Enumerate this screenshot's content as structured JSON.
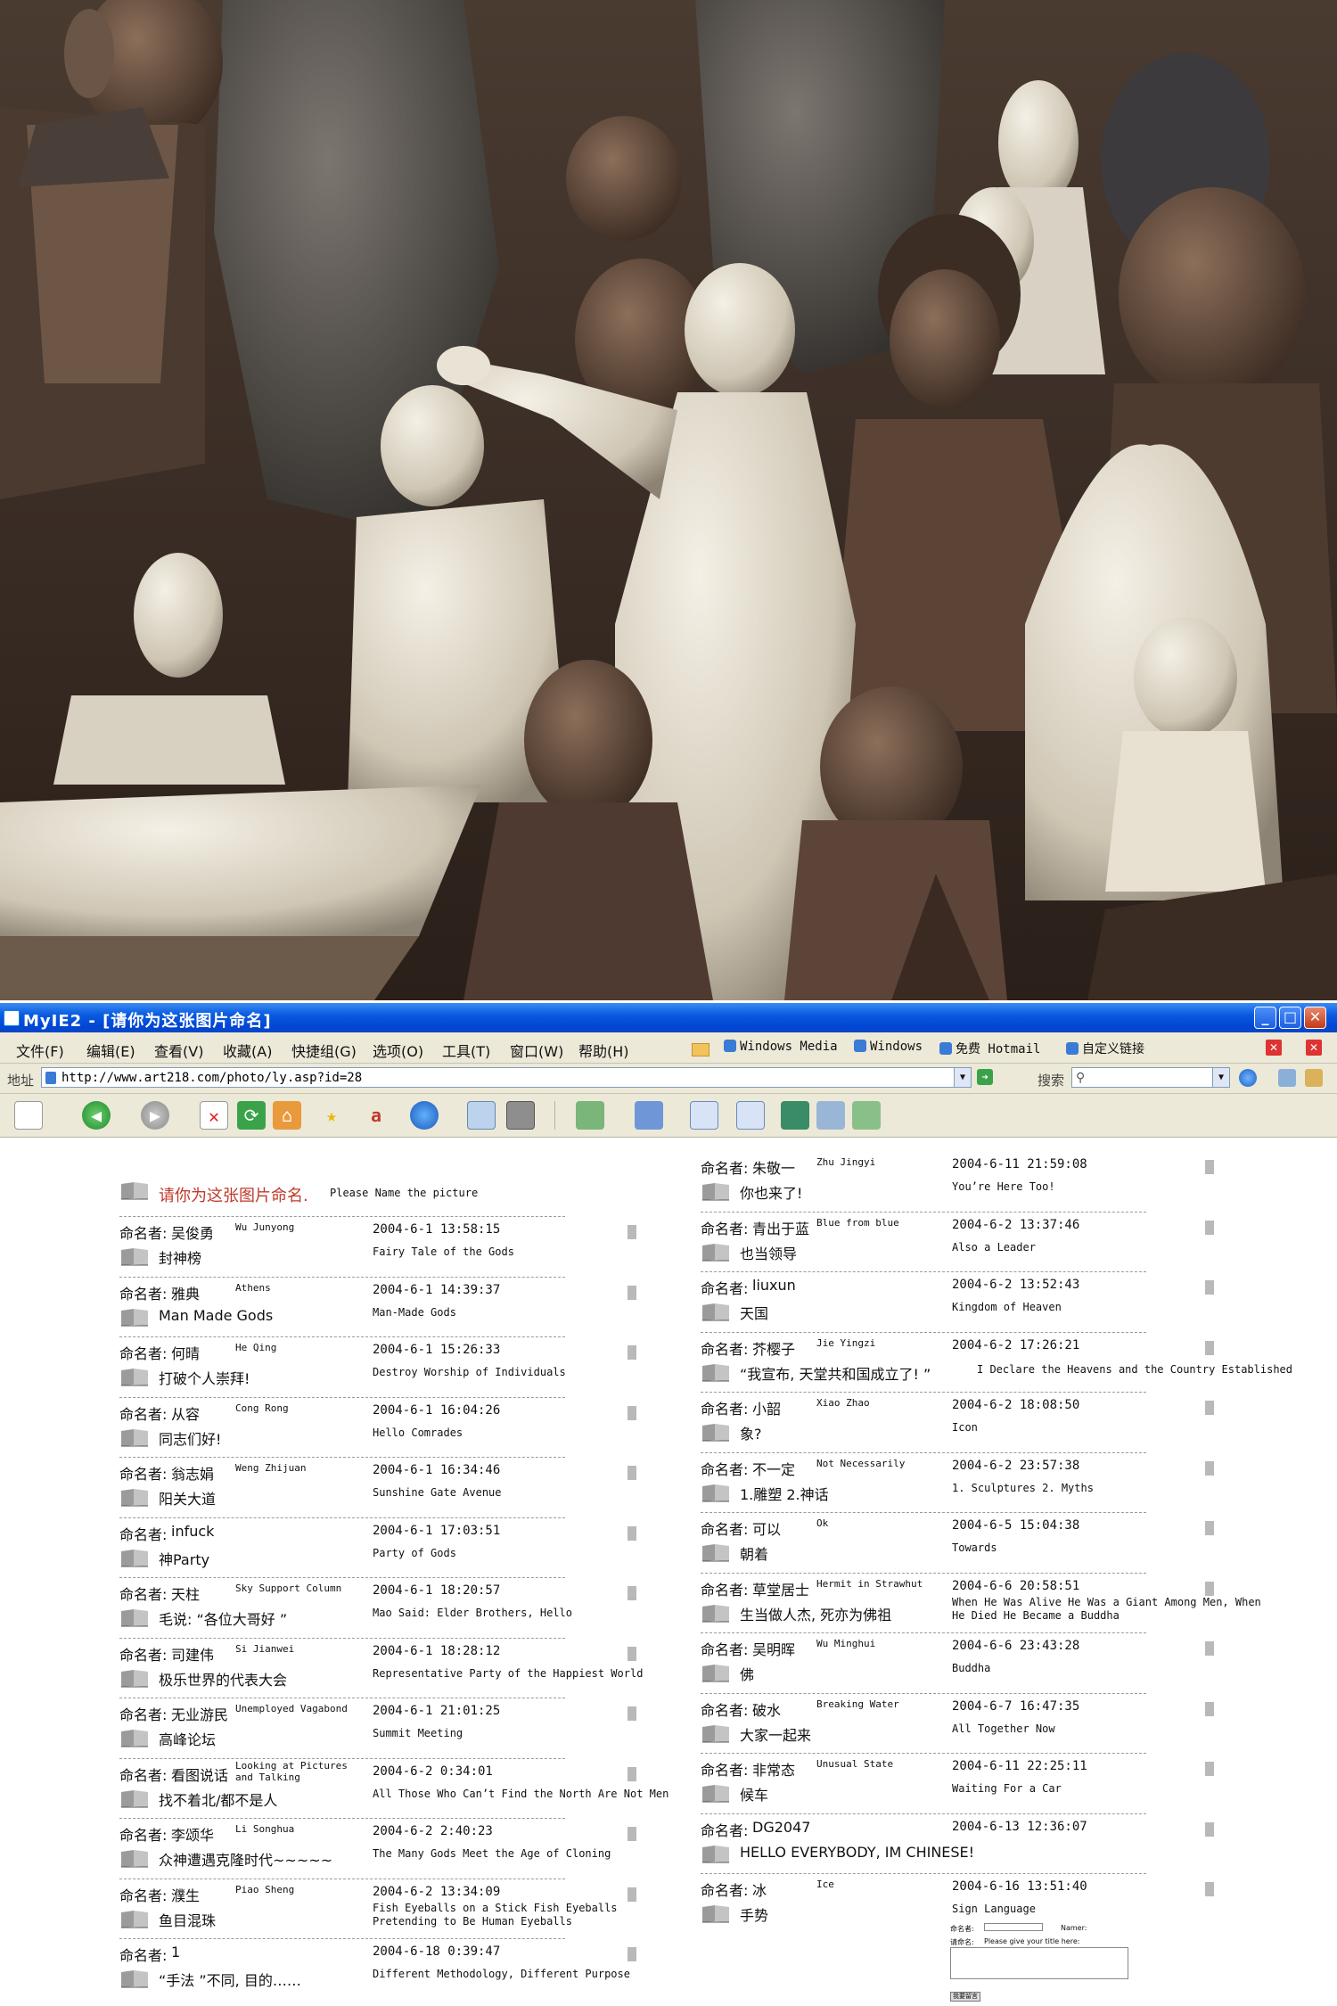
{
  "window": {
    "title": "MyIE2 - [请你为这张图片命名]",
    "minimize_glyph": "_",
    "maximize_glyph": "□",
    "close_glyph": "✕"
  },
  "menu": [
    "文件(F)",
    "编辑(E)",
    "查看(V)",
    "收藏(A)",
    "快捷组(G)",
    "选项(O)",
    "工具(T)",
    "窗口(W)",
    "帮助(H)"
  ],
  "links": [
    "Windows Media",
    "Windows",
    "免费 Hotmail",
    "自定义链接"
  ],
  "address": {
    "label": "地址",
    "url": "http://www.art218.com/photo/ly.asp?id=28",
    "search_label": "搜索"
  },
  "page": {
    "heading_cn": "请你为这张图片命名.",
    "heading_en": "Please Name the picture",
    "namer_label": "命名者:"
  },
  "left_entries": [
    {
      "namer": "吴俊勇",
      "namer_en": "Wu Junyong",
      "date": "2004-6-1 13:58:15",
      "title": "封神榜",
      "title_en": "Fairy Tale of the Gods"
    },
    {
      "namer": "雅典",
      "namer_en": "Athens",
      "date": "2004-6-1 14:39:37",
      "title": "Man Made Gods",
      "title_en": "Man-Made Gods"
    },
    {
      "namer": "何晴",
      "namer_en": "He Qing",
      "date": "2004-6-1 15:26:33",
      "title": "打破个人崇拜!",
      "title_en": "Destroy Worship of Individuals"
    },
    {
      "namer": "从容",
      "namer_en": "Cong Rong",
      "date": "2004-6-1 16:04:26",
      "title": "同志们好!",
      "title_en": "Hello Comrades"
    },
    {
      "namer": "翁志娟",
      "namer_en": "Weng Zhijuan",
      "date": "2004-6-1 16:34:46",
      "title": "阳关大道",
      "title_en": "Sunshine Gate Avenue"
    },
    {
      "namer": "infuck",
      "namer_en": "",
      "date": "2004-6-1 17:03:51",
      "title": "神Party",
      "title_en": "Party of Gods"
    },
    {
      "namer": "天柱",
      "namer_en": "Sky Support Column",
      "date": "2004-6-1 18:20:57",
      "title": "毛说: “各位大哥好 ”",
      "title_en": "Mao Said: Elder Brothers, Hello"
    },
    {
      "namer": "司建伟",
      "namer_en": "Si Jianwei",
      "date": "2004-6-1 18:28:12",
      "title": "极乐世界的代表大会",
      "title_en": "Representative Party of the Happiest World"
    },
    {
      "namer": "无业游民",
      "namer_en": "Unemployed Vagabond",
      "date": "2004-6-1 21:01:25",
      "title": "高峰论坛",
      "title_en": "Summit Meeting"
    },
    {
      "namer": "看图说话",
      "namer_en": "Looking at Pictures and Talking",
      "date": "2004-6-2 0:34:01",
      "title": "找不着北/都不是人",
      "title_en": "All Those Who Can’t Find the North Are Not Men"
    },
    {
      "namer": "李颂华",
      "namer_en": "Li Songhua",
      "date": "2004-6-2 2:40:23",
      "title": "众神遭遇克隆时代~~~~~",
      "title_en": "The Many Gods Meet the Age of Cloning"
    },
    {
      "namer": "濮生",
      "namer_en": "Piao Sheng",
      "date": "2004-6-2 13:34:09",
      "title": "鱼目混珠",
      "title_en": "Fish Eyeballs on a Stick Fish Eyeballs Pretending to Be Human Eyeballs"
    },
    {
      "namer": "1",
      "namer_en": "",
      "date": "2004-6-18 0:39:47",
      "title": "“手法 ”不同, 目的……",
      "title_en": "Different Methodology, Different Purpose"
    }
  ],
  "right_entries": [
    {
      "namer": "朱敬一",
      "namer_en": "Zhu Jingyi",
      "date": "2004-6-11 21:59:08",
      "title": "你也来了!",
      "title_en": "You’re Here Too!"
    },
    {
      "namer": "青出于蓝",
      "namer_en": "Blue from blue",
      "date": "2004-6-2 13:37:46",
      "title": "也当领导",
      "title_en": "Also a Leader"
    },
    {
      "namer": "liuxun",
      "namer_en": "",
      "date": "2004-6-2 13:52:43",
      "title": "天国",
      "title_en": "Kingdom of Heaven"
    },
    {
      "namer": "芥樱子",
      "namer_en": "Jie Yingzi",
      "date": "2004-6-2 17:26:21",
      "title": "“我宣布, 天堂共和国成立了! ”",
      "title_en": "I Declare the Heavens and the Country Established"
    },
    {
      "namer": "小韶",
      "namer_en": "Xiao Zhao",
      "date": "2004-6-2 18:08:50",
      "title": "象?",
      "title_en": "Icon"
    },
    {
      "namer": "不一定",
      "namer_en": "Not Necessarily",
      "date": "2004-6-2 23:57:38",
      "title": "1.雕塑 2.神话",
      "title_en": "1. Sculptures 2. Myths"
    },
    {
      "namer": "可以",
      "namer_en": "Ok",
      "date": "2004-6-5 15:04:38",
      "title": "朝着",
      "title_en": "Towards"
    },
    {
      "namer": "草堂居士",
      "namer_en": "Hermit in Strawhut",
      "date": "2004-6-6 20:58:51",
      "title": "生当做人杰, 死亦为佛祖",
      "title_en": "When He Was Alive He Was a Giant Among Men, When He Died He Became a Buddha"
    },
    {
      "namer": "吴明晖",
      "namer_en": "Wu Minghui",
      "date": "2004-6-6 23:43:28",
      "title": "佛",
      "title_en": "Buddha"
    },
    {
      "namer": "破水",
      "namer_en": "Breaking Water",
      "date": "2004-6-7 16:47:35",
      "title": "大家一起来",
      "title_en": "All Together Now"
    },
    {
      "namer": "非常态",
      "namer_en": "Unusual State",
      "date": "2004-6-11 22:25:11",
      "title": "候车",
      "title_en": "Waiting For a Car"
    },
    {
      "namer": "DG2047",
      "namer_en": "",
      "date": "2004-6-13 12:36:07",
      "title": "HELLO EVERYBODY, IM CHINESE!",
      "title_en": ""
    },
    {
      "namer": "冰",
      "namer_en": "Ice",
      "date": "2004-6-16 13:51:40",
      "title": "手势",
      "title_en": "Sign Language"
    }
  ],
  "form": {
    "namer_label": "命名者:",
    "namer_en": "Namer:",
    "title_label": "请命名:",
    "title_en": "Please give your title here:",
    "submit": "我要留言"
  }
}
